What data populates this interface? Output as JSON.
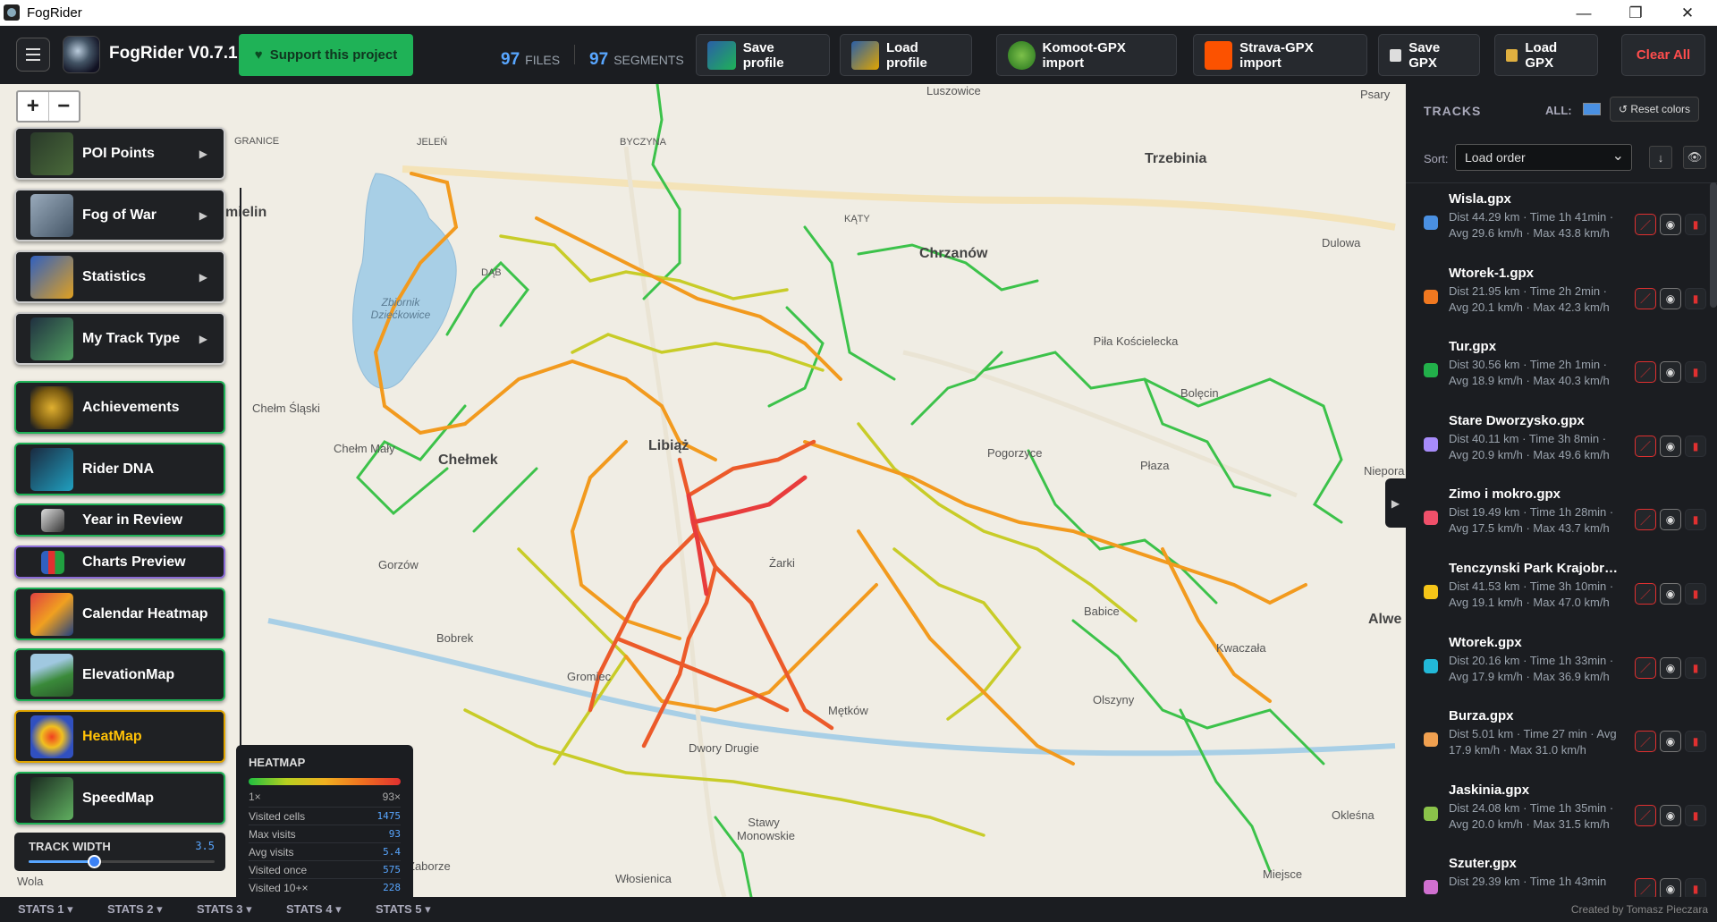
{
  "window": {
    "title": "FogRider",
    "minimize": "—",
    "maximize": "❐",
    "close": "✕"
  },
  "header": {
    "brand": "FogRider V0.7.1",
    "support_label": "Support this project",
    "files_count": "97",
    "files_label": "FILES",
    "segments_count": "97",
    "segments_label": "SEGMENTS",
    "save_profile": "Save profile",
    "load_profile": "Load profile",
    "komoot_import": "Komoot-GPX import",
    "strava_import": "Strava-GPX import",
    "save_gpx": "Save GPX",
    "load_gpx": "Load GPX",
    "clear_all": "Clear All"
  },
  "zoom": {
    "in": "+",
    "out": "−"
  },
  "menu": {
    "poi": "POI Points",
    "fog": "Fog of War",
    "statistics": "Statistics",
    "track_type": "My Track Type",
    "achievements": "Achievements",
    "rider_dna": "Rider DNA",
    "year_review": "Year in Review",
    "charts_preview": "Charts Preview",
    "calendar_heatmap": "Calendar Heatmap",
    "elevation_map": "ElevationMap",
    "heat_map": "HeatMap",
    "speed_map": "SpeedMap",
    "arrow": "▶"
  },
  "track_width": {
    "label": "TRACK WIDTH",
    "value": "3.5",
    "level": 0.35
  },
  "heatmap_legend": {
    "title": "HEATMAP",
    "min": "1×",
    "max": "93×",
    "rows": [
      {
        "label": "Visited cells",
        "value": "1475"
      },
      {
        "label": "Max visits",
        "value": "93"
      },
      {
        "label": "Avg visits",
        "value": "5.4"
      },
      {
        "label": "Visited once",
        "value": "575"
      },
      {
        "label": "Visited 10+×",
        "value": "228"
      }
    ]
  },
  "map_places": [
    {
      "name": "Luszowice",
      "cls": ""
    },
    {
      "name": "Psary",
      "cls": ""
    },
    {
      "name": "GRANICE",
      "cls": ""
    },
    {
      "name": "JELEŃ",
      "cls": ""
    },
    {
      "name": "BYCZYNA",
      "cls": ""
    },
    {
      "name": "Trzebinia",
      "cls": "big"
    },
    {
      "name": "mielin",
      "cls": "big"
    },
    {
      "name": "KĄTY",
      "cls": ""
    },
    {
      "name": "Dulowa",
      "cls": ""
    },
    {
      "name": "DĄB",
      "cls": ""
    },
    {
      "name": "Chrzanów",
      "cls": "big"
    },
    {
      "name": "Zbiornik Dziećkowice",
      "cls": "it"
    },
    {
      "name": "Piła Kościelecka",
      "cls": ""
    },
    {
      "name": "Bolęcin",
      "cls": ""
    },
    {
      "name": "Chełm Śląski",
      "cls": ""
    },
    {
      "name": "Chełm Mały",
      "cls": ""
    },
    {
      "name": "Chełmek",
      "cls": "big"
    },
    {
      "name": "Libiąż",
      "cls": "big"
    },
    {
      "name": "Pogorzyce",
      "cls": ""
    },
    {
      "name": "Płaza",
      "cls": ""
    },
    {
      "name": "Niepora",
      "cls": ""
    },
    {
      "name": "Żarki",
      "cls": ""
    },
    {
      "name": "Gorzów",
      "cls": ""
    },
    {
      "name": "Babice",
      "cls": ""
    },
    {
      "name": "Alwe",
      "cls": "big"
    },
    {
      "name": "Bobrek",
      "cls": ""
    },
    {
      "name": "Kwaczała",
      "cls": ""
    },
    {
      "name": "Gromiec",
      "cls": ""
    },
    {
      "name": "Olszyny",
      "cls": ""
    },
    {
      "name": "Mętków",
      "cls": ""
    },
    {
      "name": "Dwory Drugie",
      "cls": ""
    },
    {
      "name": "Okleśna",
      "cls": ""
    },
    {
      "name": "Stawy Monowskie",
      "cls": ""
    },
    {
      "name": "Zaborze",
      "cls": ""
    },
    {
      "name": "Włosienica",
      "cls": ""
    },
    {
      "name": "Miejsce",
      "cls": ""
    },
    {
      "name": "Wola",
      "cls": ""
    }
  ],
  "panel": {
    "title": "TRACKS",
    "all_label": "ALL:",
    "all_color": "#4a90e2",
    "reset_colors": "↺ Reset colors",
    "sort_label": "Sort:",
    "sort_value": "Load order",
    "sort_dir": "↓",
    "eye_all": "👁"
  },
  "tracks": [
    {
      "name": "Wisla.gpx",
      "details": "Dist 44.29 km · Time 1h 41min · Avg 29.6 km/h · Max 43.8 km/h",
      "color": "#4a90e2"
    },
    {
      "name": "Wtorek-1.gpx",
      "details": "Dist 21.95 km · Time 2h 2min · Avg 20.1 km/h · Max 42.3 km/h",
      "color": "#f07820"
    },
    {
      "name": "Tur.gpx",
      "details": "Dist 30.56 km · Time 2h 1min · Avg 18.9 km/h · Max 40.3 km/h",
      "color": "#22b04a"
    },
    {
      "name": "Stare Dworzysko.gpx",
      "details": "Dist 40.11 km · Time 3h 8min · Avg 20.9 km/h · Max 49.6 km/h",
      "color": "#a78bfa"
    },
    {
      "name": "Zimo i mokro.gpx",
      "details": "Dist 19.49 km · Time 1h 28min · Avg 17.5 km/h · Max 43.7 km/h",
      "color": "#f0506a"
    },
    {
      "name": "Tenczynski Park Krajobrazowy.gpx",
      "details": "Dist 41.53 km · Time 3h 10min · Avg 19.1 km/h · Max 47.0 km/h",
      "color": "#f5c518"
    },
    {
      "name": "Wtorek.gpx",
      "details": "Dist 20.16 km · Time 1h 33min · Avg 17.9 km/h · Max 36.9 km/h",
      "color": "#22b8d8"
    },
    {
      "name": "Burza.gpx",
      "details": "Dist 5.01 km · Time 27 min · Avg 17.9 km/h · Max 31.0 km/h",
      "color": "#f0a050"
    },
    {
      "name": "Jaskinia.gpx",
      "details": "Dist 24.08 km · Time 1h 35min · Avg 20.0 km/h · Max 31.5 km/h",
      "color": "#8bc34a"
    },
    {
      "name": "Szuter.gpx",
      "details": "Dist 29.39 km · Time 1h 43min",
      "color": "#d070d0"
    }
  ],
  "stats_tabs": [
    "STATS 1 ▾",
    "STATS 2 ▾",
    "STATS 3 ▾",
    "STATS 4 ▾",
    "STATS 5 ▾"
  ],
  "credit": "Created by Tomasz Pieczara",
  "collapse_arrow": "▶"
}
